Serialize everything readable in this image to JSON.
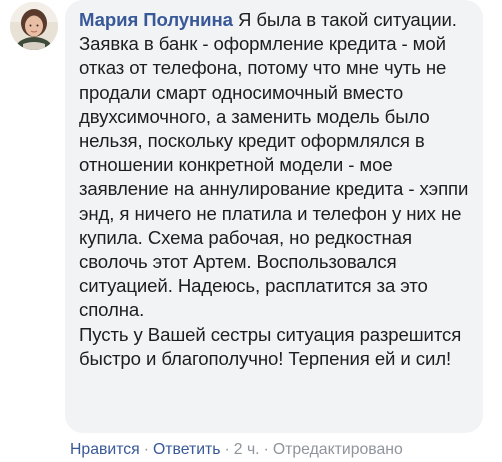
{
  "comment": {
    "author": "Мария Полунина",
    "text": " Я была в такой ситуации. Заявка в банк - оформление кредита - мой отказ от телефона, потому что мне чуть не продали смарт односимочный вместо двухсимочного, а заменить модель было нельзя, поскольку кредит оформлялся в отношении конкретной модели - мое заявление на аннулирование кредита - хэппи энд, я ничего не платила и телефон у них не купила. Схема рабочая, но редкостная сволочь этот Артем. Воспользовался ситуацией. Надеюсь, расплатится за это сполна.",
    "text2": "Пусть у Вашей сестры ситуация разрешится быстро и благополучно! Терпения ей и сил!"
  },
  "actions": {
    "like": "Нравится",
    "reply": "Ответить",
    "separator": "·",
    "time": "2 ч.",
    "edited": "Отредактировано"
  },
  "colors": {
    "bubble": "#f2f3f5",
    "author": "#385898",
    "text": "#1c1e21",
    "meta": "#90949c"
  }
}
